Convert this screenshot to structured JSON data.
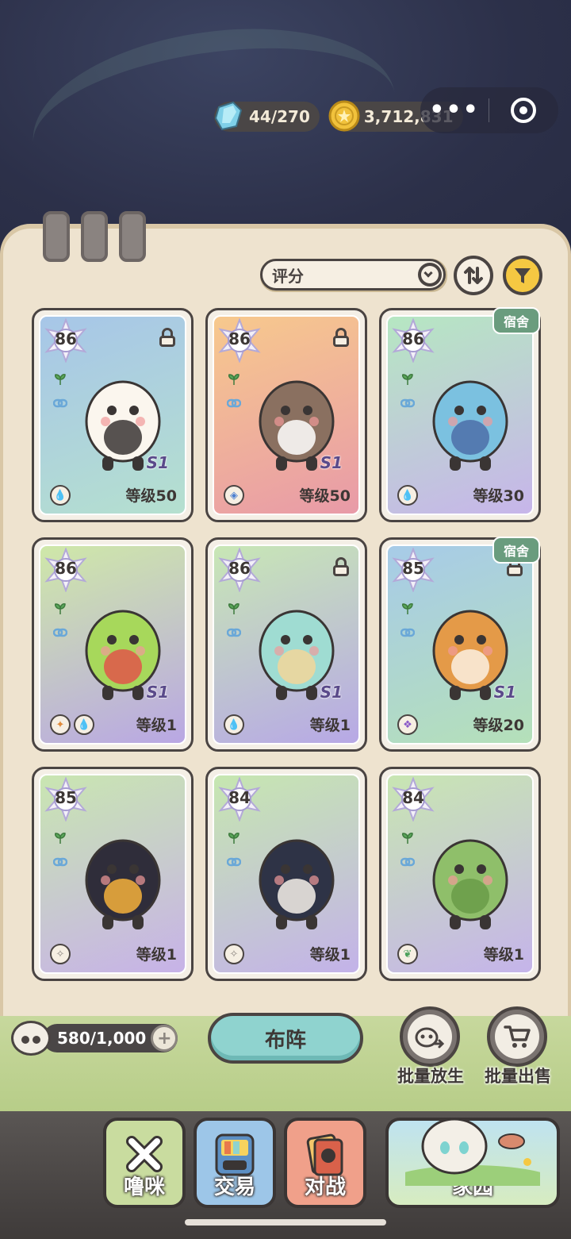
{
  "resources": {
    "stamina": "44/270",
    "coins": "3,712,831"
  },
  "capsule": {
    "more_icon": "more-dots-icon",
    "close_icon": "target-icon"
  },
  "sort": {
    "label": "评分",
    "dropdown_icon": "chevron-down-icon",
    "order_icon": "sort-order-icon",
    "filter_icon": "filter-icon"
  },
  "cards": [
    {
      "rating": "86",
      "locked": true,
      "dorm": "",
      "level": "等级50",
      "badge": "S1",
      "bg": [
        "#a7c6e8",
        "#b5e0cf"
      ],
      "elements": [
        "water"
      ],
      "monster": "white-chick-ballerina"
    },
    {
      "rating": "86",
      "locked": true,
      "dorm": "",
      "level": "等级50",
      "badge": "S1",
      "bg": [
        "#f7c98d",
        "#e89aa8"
      ],
      "elements": [
        "blue-rune"
      ],
      "monster": "coffee-cup-creature"
    },
    {
      "rating": "86",
      "locked": false,
      "dorm": "宿舍",
      "level": "等级30",
      "badge": "",
      "bg": [
        "#b6e7c2",
        "#c7b5ea"
      ],
      "elements": [
        "water"
      ],
      "monster": "blue-horned-bull"
    },
    {
      "rating": "86",
      "locked": false,
      "dorm": "",
      "level": "等级1",
      "badge": "S1",
      "bg": [
        "#cfe8a8",
        "#b9a7e4"
      ],
      "elements": [
        "orange-rune",
        "water"
      ],
      "monster": "green-mantis-boxer"
    },
    {
      "rating": "86",
      "locked": true,
      "dorm": "",
      "level": "等级1",
      "badge": "S1",
      "bg": [
        "#c8e7b5",
        "#b7a8e6"
      ],
      "elements": [
        "water"
      ],
      "monster": "teal-baby-dragon"
    },
    {
      "rating": "85",
      "locked": true,
      "dorm": "宿舍",
      "level": "等级20",
      "badge": "S1",
      "bg": [
        "#a7cbe8",
        "#b5e0b9"
      ],
      "elements": [
        "purple-rune"
      ],
      "monster": "orange-rock-golem"
    },
    {
      "rating": "85",
      "locked": false,
      "dorm": "",
      "level": "等级1",
      "badge": "",
      "bg": [
        "#c9e6b1",
        "#c7b2e8"
      ],
      "elements": [
        "neutral"
      ],
      "monster": "toucan-pharaoh"
    },
    {
      "rating": "84",
      "locked": false,
      "dorm": "",
      "level": "等级1",
      "badge": "",
      "bg": [
        "#c6e7b0",
        "#c3b2e9"
      ],
      "elements": [
        "neutral"
      ],
      "monster": "penguin-student"
    },
    {
      "rating": "84",
      "locked": false,
      "dorm": "",
      "level": "等级1",
      "badge": "",
      "bg": [
        "#c8e6b2",
        "#c5b4ea"
      ],
      "elements": [
        "green-rune"
      ],
      "monster": "propeller-parrot"
    }
  ],
  "capacity": "580/1,000",
  "deploy_label": "布阵",
  "actions": {
    "release": "批量放生",
    "sell": "批量出售"
  },
  "nav": {
    "pet": "噜咪",
    "trade": "交易",
    "battle": "对战",
    "home": "家园"
  },
  "colors": {
    "panel": "#eee3cf",
    "outline": "#4a4442",
    "accent": "#8fd3cf",
    "filter_yellow": "#f5c842",
    "dorm_green": "#6a9c7e"
  }
}
